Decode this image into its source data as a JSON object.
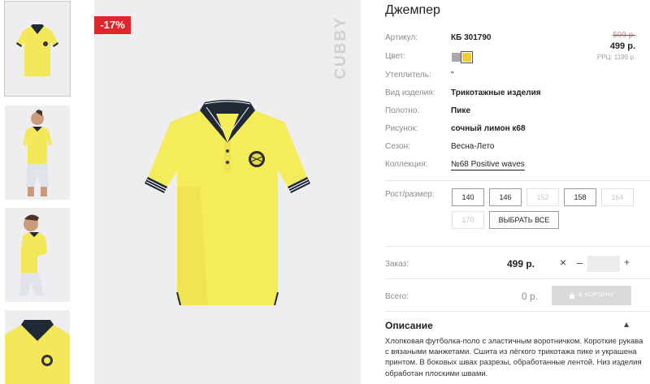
{
  "product": {
    "title": "Джемпер",
    "discount_badge": "-17%",
    "brand": "CUBBY"
  },
  "specs": [
    {
      "label": "Артикул:",
      "value": "КБ 301790"
    },
    {
      "label": "Цвет:",
      "value": ""
    },
    {
      "label": "Утеплитель:",
      "value": "\""
    },
    {
      "label": "Вид изделия:",
      "value": "Трикотажные изделия"
    },
    {
      "label": "Полотно:",
      "value": "Пике"
    },
    {
      "label": "Рисунок:",
      "value": "сочный лимон к68"
    },
    {
      "label": "Сезон:",
      "value": "Весна-Лето"
    },
    {
      "label": "Коллекция:",
      "value": "№68 Positive waves"
    }
  ],
  "colors": {
    "swatches": [
      {
        "name": "grey",
        "hex": "#a8a8a8"
      },
      {
        "name": "yellow",
        "hex": "#f2cf2f",
        "selected": true
      }
    ],
    "accent_red": "#e0262c"
  },
  "price": {
    "old": "599 р.",
    "current": "499 р.",
    "rrp": "РРЦ: 1199 р."
  },
  "sizes": {
    "label": "Рост/размер:",
    "options": [
      {
        "value": "140",
        "available": true
      },
      {
        "value": "146",
        "available": true
      },
      {
        "value": "152",
        "available": false
      },
      {
        "value": "158",
        "available": true
      },
      {
        "value": "164",
        "available": false
      },
      {
        "value": "170",
        "available": false
      }
    ],
    "select_all": "ВЫБРАТЬ ВСЕ"
  },
  "order": {
    "label": "Заказ:",
    "price": "499 р.",
    "remove_icon": "×",
    "minus": "–",
    "plus": "+",
    "quantity": ""
  },
  "total": {
    "label": "Всего:",
    "value": "0 р.",
    "cart_button": "В КОРЗИНУ"
  },
  "description": {
    "title": "Описание",
    "toggle": "▴",
    "text": "Хлопковая футболка-поло с эластичным воротничком. Короткие рукава с вязаными манжетами. Сшита из лёгкого трикотажа пике и украшена принтом. В боковых швах разрезы, обработанные лентой. Низ изделия обработан плоскими швами."
  }
}
